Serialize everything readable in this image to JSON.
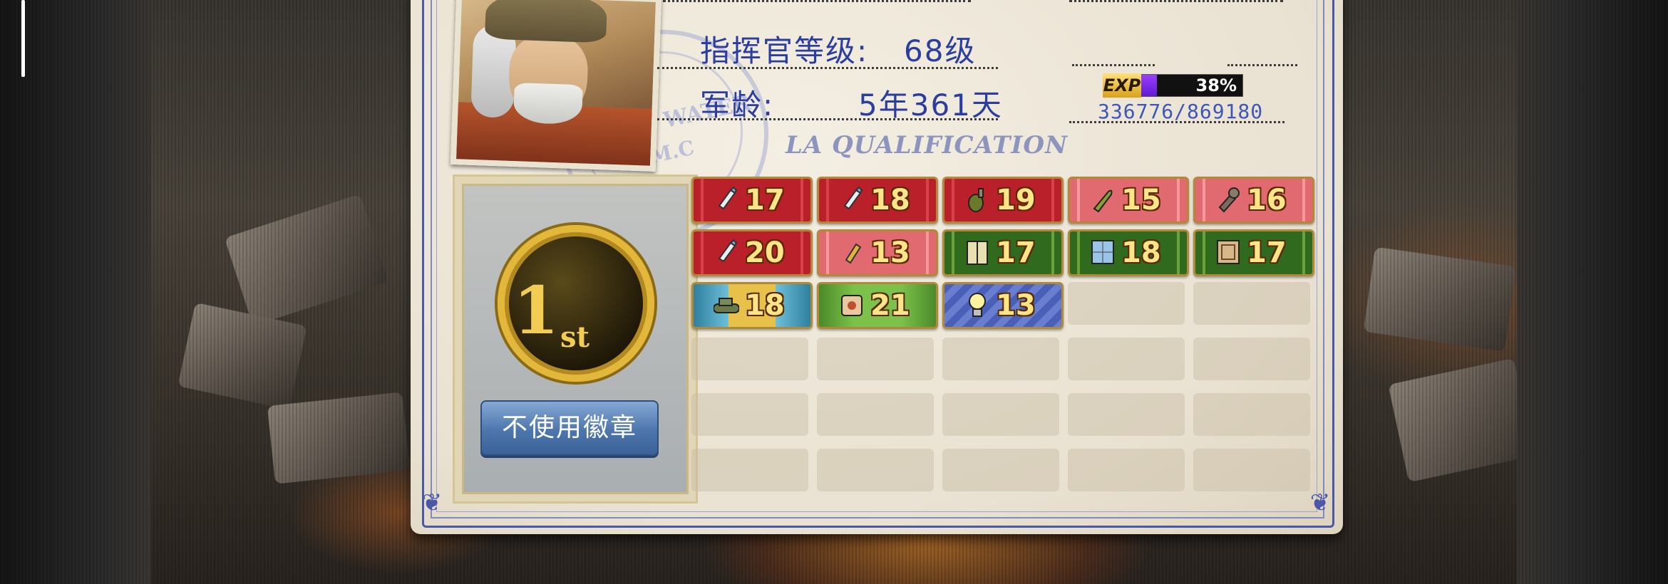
{
  "profile": {
    "level_label": "指挥官等级:",
    "level_value": "68级",
    "service_label": "军龄:",
    "service_value": "5年361天"
  },
  "exp": {
    "tag": "EXP",
    "percent_text": "38%",
    "progress": 0.38,
    "value_text": "336776/869180"
  },
  "stamp": {
    "lines": [
      "DAYS WATER",
      "A.M.C"
    ]
  },
  "qualification_title": "LA QUALIFICATION",
  "medal": {
    "rank": "1",
    "suffix": "st"
  },
  "buttons": {
    "no_badge": "不使用徽章"
  },
  "badges": [
    {
      "icon": "bullet-icon",
      "value": "17",
      "style": "red"
    },
    {
      "icon": "bullet-icon",
      "value": "18",
      "style": "red"
    },
    {
      "icon": "grenade-icon",
      "value": "19",
      "style": "red"
    },
    {
      "icon": "shell-icon",
      "value": "15",
      "style": "pink"
    },
    {
      "icon": "rocket-icon",
      "value": "16",
      "style": "pink"
    },
    {
      "icon": "bullet-icon",
      "value": "20",
      "style": "red"
    },
    {
      "icon": "cartridge-icon",
      "value": "13",
      "style": "pink"
    },
    {
      "icon": "gate-icon",
      "value": "17",
      "style": "green"
    },
    {
      "icon": "window-icon",
      "value": "18",
      "style": "green"
    },
    {
      "icon": "crate-icon",
      "value": "17",
      "style": "green"
    },
    {
      "icon": "tank-icon",
      "value": "18",
      "style": "teal"
    },
    {
      "icon": "fortress-icon",
      "value": "21",
      "style": "lime"
    },
    {
      "icon": "lightbulb-icon",
      "value": "13",
      "style": "blue"
    }
  ],
  "empty_slots": 17,
  "colors": {
    "accent_blue": "#2b3d9e",
    "frame_blue": "#4a58a8",
    "button_blue": "#4d76ad",
    "exp_purple": "#7a2be8",
    "medal_gold": "#e3b83a"
  }
}
